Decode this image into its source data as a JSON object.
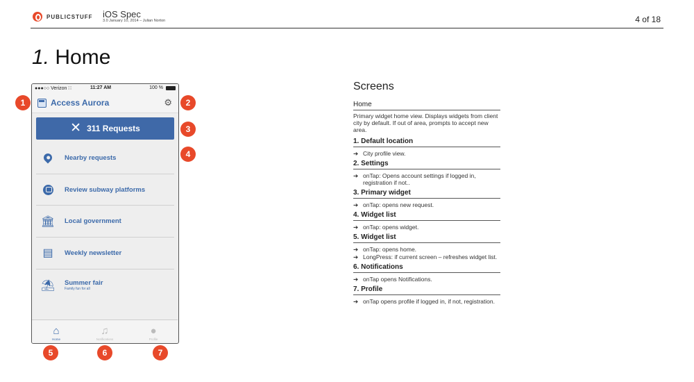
{
  "header": {
    "brand": "PUBLICSTUFF",
    "title": "iOS Spec",
    "subtitle": "3.0 January 10, 2014 – Julian Norton",
    "page": "4 of 18"
  },
  "section": {
    "number": "1.",
    "title": "Home"
  },
  "phone": {
    "status": {
      "carrier": "●●●○○ Verizon ∷",
      "time": "11:27 AM",
      "battery": "100 %"
    },
    "city_name": "Access Aurora",
    "primary_widget": "311 Requests",
    "widgets": [
      {
        "label": "Nearby requests",
        "sub": "",
        "icon": "map-pin-icon"
      },
      {
        "label": "Review subway platforms",
        "sub": "",
        "icon": "train-icon"
      },
      {
        "label": "Local government",
        "sub": "",
        "icon": "government-building-icon"
      },
      {
        "label": "Weekly newsletter",
        "sub": "",
        "icon": "newsletter-icon"
      },
      {
        "label": "Summer fair",
        "sub": "Family fun for all",
        "icon": "carousel-icon"
      }
    ],
    "tabs": [
      {
        "label": "Home",
        "icon": "home-icon",
        "active": true
      },
      {
        "label": "Notifications",
        "icon": "bell-icon",
        "active": false
      },
      {
        "label": "Profile",
        "icon": "profile-icon",
        "active": false
      }
    ]
  },
  "callouts": [
    "1",
    "2",
    "3",
    "4",
    "5",
    "6",
    "7"
  ],
  "spec": {
    "heading": "Screens",
    "screen_name": "Home",
    "screen_desc": "Primary widget home view. Displays widgets from client city by default. If out of area, prompts to accept new area.",
    "items": [
      {
        "title": "1. Default location",
        "lines": [
          "City profile view."
        ]
      },
      {
        "title": "2. Settings",
        "lines": [
          "onTap: Opens account settings if logged in, registration if not.."
        ]
      },
      {
        "title": "3. Primary widget",
        "lines": [
          "onTap: opens new request."
        ]
      },
      {
        "title": "4. Widget list",
        "lines": [
          "onTap: opens widget."
        ]
      },
      {
        "title": "5. Widget list",
        "lines": [
          "onTap: opens home.",
          "LongPress: if current screen – refreshes widget list."
        ]
      },
      {
        "title": "6. Notifications",
        "lines": [
          "onTap opens Notifications."
        ]
      },
      {
        "title": "7. Profile",
        "lines": [
          "onTap opens profile if logged in, if not, registration."
        ]
      }
    ]
  },
  "colors": {
    "accent": "#3c6aaa",
    "callout": "#e8492a"
  }
}
